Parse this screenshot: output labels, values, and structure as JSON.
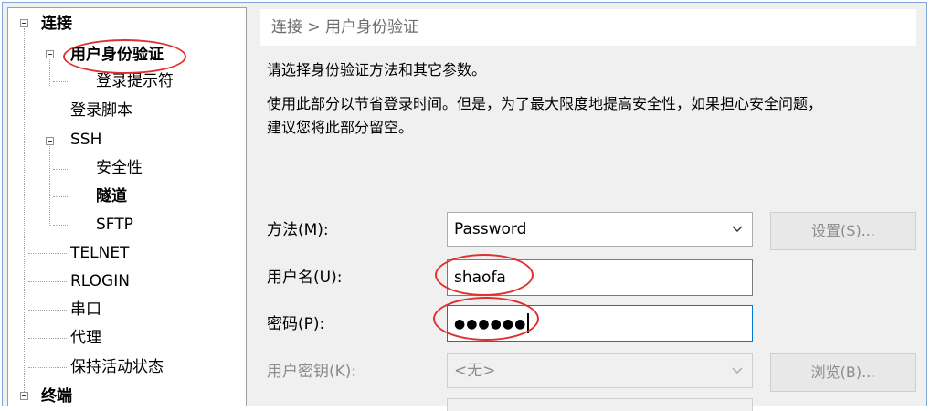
{
  "tree": {
    "items": [
      {
        "label": "连接",
        "bold": true
      },
      {
        "label": "用户身份验证",
        "bold": true
      },
      {
        "label": "登录提示符",
        "bold": false
      },
      {
        "label": "登录脚本",
        "bold": false
      },
      {
        "label": "SSH",
        "bold": false
      },
      {
        "label": "安全性",
        "bold": false
      },
      {
        "label": "隧道",
        "bold": true
      },
      {
        "label": "SFTP",
        "bold": false
      },
      {
        "label": "TELNET",
        "bold": false
      },
      {
        "label": "RLOGIN",
        "bold": false
      },
      {
        "label": "串口",
        "bold": false
      },
      {
        "label": "代理",
        "bold": false
      },
      {
        "label": "保持活动状态",
        "bold": false
      },
      {
        "label": "终端",
        "bold": true
      }
    ]
  },
  "breadcrumb": "连接 > 用户身份验证",
  "description": {
    "line1": "请选择身份验证方法和其它参数。",
    "line2": "使用此部分以节省登录时间。但是，为了最大限度地提高安全性，如果担心安全问题，",
    "line3": "建议您将此部分留空。"
  },
  "form": {
    "method_label": "方法(M):",
    "method_value": "Password",
    "settings_button": "设置(S)...",
    "username_label": "用户名(U):",
    "username_value": "shaofa",
    "password_label": "密码(P):",
    "password_value": "●●●●●●",
    "userkey_label": "用户密钥(K):",
    "userkey_value": "<无>",
    "browse_button": "浏览(B)..."
  },
  "colors": {
    "annotation": "#e03030",
    "focus_border": "#0078d7"
  }
}
